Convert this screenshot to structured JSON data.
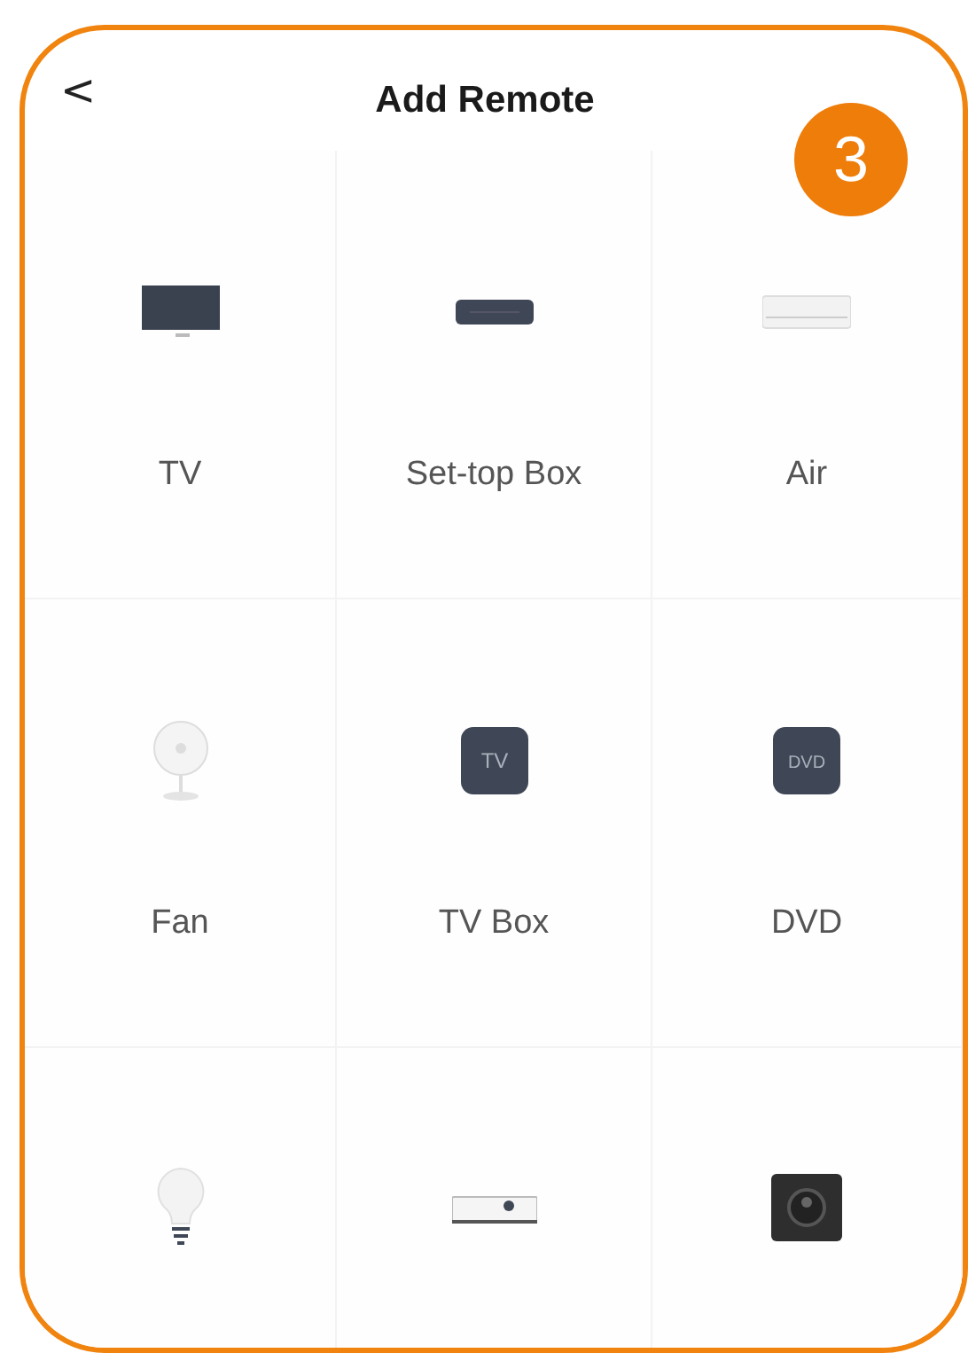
{
  "header": {
    "back_glyph": "<",
    "title": "Add Remote"
  },
  "step_badge": "3",
  "devices": [
    {
      "kind": "tv",
      "label": "TV"
    },
    {
      "kind": "settop",
      "label": "Set-top Box"
    },
    {
      "kind": "air",
      "label": "Air"
    },
    {
      "kind": "fan",
      "label": "Fan"
    },
    {
      "kind": "tvbox",
      "label": "TV Box",
      "icon_text": "TV"
    },
    {
      "kind": "dvd",
      "label": "DVD",
      "icon_text": "DVD"
    },
    {
      "kind": "bulb"
    },
    {
      "kind": "projector"
    },
    {
      "kind": "speaker"
    }
  ]
}
